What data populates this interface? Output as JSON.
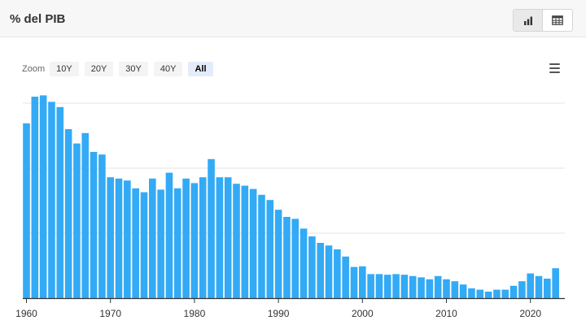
{
  "header": {
    "title": "% del PIB",
    "view_buttons": [
      {
        "name": "chart-view-button",
        "icon": "bar-chart-icon",
        "active": true
      },
      {
        "name": "table-view-button",
        "icon": "table-icon",
        "active": false
      }
    ]
  },
  "zoom": {
    "label": "Zoom",
    "options": [
      "10Y",
      "20Y",
      "30Y",
      "40Y",
      "All"
    ],
    "selected": "All"
  },
  "menu_icon": "hamburger-menu-icon",
  "colors": {
    "bar": "#33aaf5",
    "grid": "#e6e6e6",
    "axis": "#333333"
  },
  "chart_data": {
    "type": "bar",
    "title": "",
    "xlabel": "",
    "ylabel": "",
    "x": [
      1960,
      1961,
      1962,
      1963,
      1964,
      1965,
      1966,
      1967,
      1968,
      1969,
      1970,
      1971,
      1972,
      1973,
      1974,
      1975,
      1976,
      1977,
      1978,
      1979,
      1980,
      1981,
      1982,
      1983,
      1984,
      1985,
      1986,
      1987,
      1988,
      1989,
      1990,
      1991,
      1992,
      1993,
      1994,
      1995,
      1996,
      1997,
      1998,
      1999,
      2000,
      2001,
      2002,
      2003,
      2004,
      2005,
      2006,
      2007,
      2008,
      2009,
      2010,
      2011,
      2012,
      2013,
      2014,
      2015,
      2016,
      2017,
      2018,
      2019,
      2020,
      2021,
      2022,
      2023
    ],
    "values": [
      26.9,
      31.0,
      31.2,
      30.2,
      29.4,
      26.0,
      23.8,
      25.4,
      22.5,
      22.1,
      18.6,
      18.4,
      18.1,
      16.9,
      16.3,
      18.4,
      16.7,
      19.3,
      16.9,
      18.4,
      17.7,
      18.6,
      21.4,
      18.6,
      18.6,
      17.6,
      17.3,
      16.8,
      15.9,
      15.1,
      13.6,
      12.5,
      12.2,
      10.7,
      9.5,
      8.5,
      8.1,
      7.5,
      6.4,
      4.8,
      4.9,
      3.7,
      3.7,
      3.6,
      3.7,
      3.6,
      3.4,
      3.2,
      2.9,
      3.4,
      2.9,
      2.6,
      2.1,
      1.5,
      1.3,
      1.0,
      1.3,
      1.3,
      1.9,
      2.6,
      3.8,
      3.4,
      3.0,
      4.6
    ],
    "ylim": [
      0,
      30
    ],
    "x_ticks": [
      1960,
      1970,
      1980,
      1990,
      2000,
      2010,
      2020
    ],
    "x_tick_labels": [
      "1960",
      "1970",
      "1980",
      "1990",
      "2000",
      "2010",
      "2020"
    ],
    "grid": true,
    "legend": "none"
  }
}
